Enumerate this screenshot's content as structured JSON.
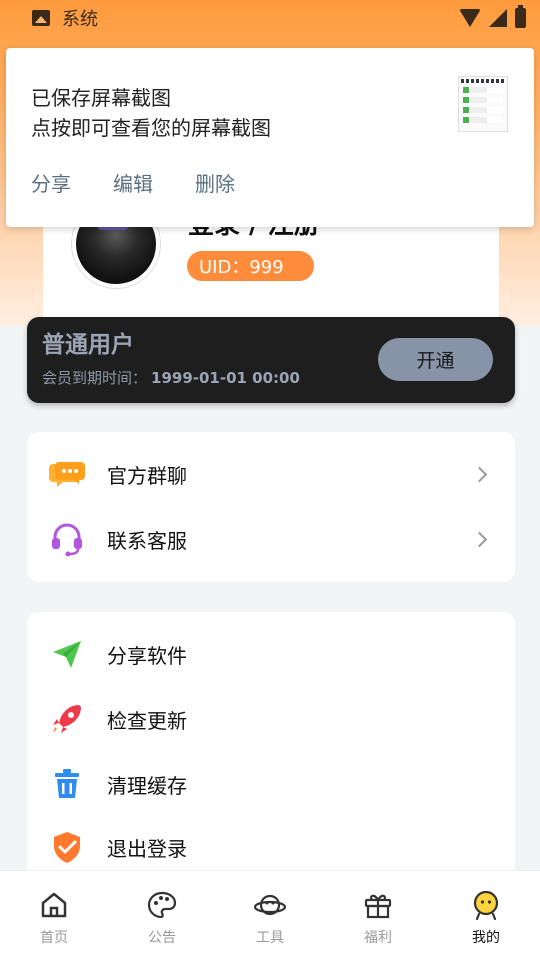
{
  "status_bar": {
    "app_label": "系统"
  },
  "notification": {
    "title": "已保存屏幕截图",
    "subtitle": "点按即可查看您的屏幕截图",
    "actions": [
      "分享",
      "编辑",
      "删除"
    ]
  },
  "profile": {
    "login_label": "登录 / 注册",
    "uid_label": "UID：999"
  },
  "vip": {
    "level": "普通用户",
    "expire_label": "会员到期时间：",
    "expire_value": "1999-01-01 00:00",
    "open_button": "开通"
  },
  "menu_group_1": {
    "items": [
      {
        "label": "官方群聊",
        "icon": "chat-bubble-icon",
        "color": "#ff9f1c"
      },
      {
        "label": "联系客服",
        "icon": "headset-icon",
        "color": "#b455e0"
      }
    ]
  },
  "menu_group_2": {
    "items": [
      {
        "label": "分享软件",
        "icon": "paper-plane-icon",
        "color": "#4cc94c"
      },
      {
        "label": "检查更新",
        "icon": "rocket-icon",
        "color": "#f03a4a"
      },
      {
        "label": "清理缓存",
        "icon": "trash-icon",
        "color": "#2f8cf0"
      },
      {
        "label": "退出登录",
        "icon": "shield-check-icon",
        "color": "#ff7a2e"
      }
    ]
  },
  "bottom_nav": {
    "items": [
      {
        "label": "首页",
        "icon": "home-icon"
      },
      {
        "label": "公告",
        "icon": "palette-icon"
      },
      {
        "label": "工具",
        "icon": "planet-icon"
      },
      {
        "label": "福利",
        "icon": "gift-icon"
      },
      {
        "label": "我的",
        "icon": "user-avatar-icon"
      }
    ],
    "active_index": 4
  },
  "colors": {
    "accent": "#ff8c3a",
    "vip_bg": "#1e1e1e",
    "vip_button": "#8793a7"
  }
}
